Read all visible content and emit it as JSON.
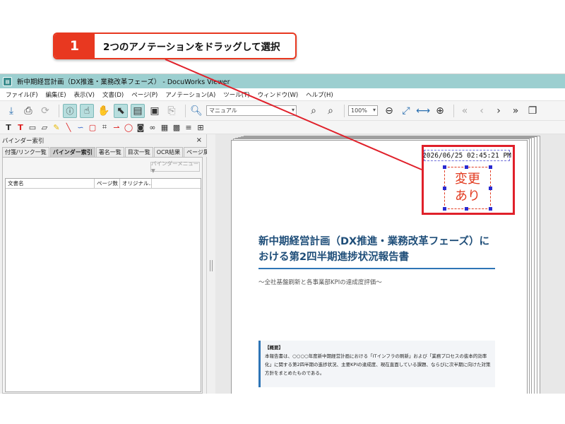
{
  "callout": {
    "step": "1",
    "text": "2つのアノテーションをドラッグして選択"
  },
  "window": {
    "title": "新中期経営計画（DX推進・業務改革フェーズ） - DocuWorks Viewer"
  },
  "menu": [
    "ファイル(F)",
    "編集(E)",
    "表示(V)",
    "文書(D)",
    "ページ(P)",
    "アノテーション(A)",
    "ツール(T)",
    "ウィンドウ(W)",
    "ヘルプ(H)"
  ],
  "toolbar": {
    "search_value": "マニュアル",
    "zoom_value": "100%"
  },
  "panel": {
    "title": "バインダー索引",
    "close": "×",
    "tabs": [
      "付箋/リンク一覧",
      "バインダー索引",
      "署名一覧",
      "目次一覧",
      "OCR結果",
      "ページ属性"
    ],
    "binder_menu": "バインダーメニュー ▼",
    "columns": [
      "文書名",
      "ページ数",
      "オリジナル..."
    ]
  },
  "document": {
    "date_stamp": "2026/06/25 02:45:21 PM",
    "change_stamp_line1": "変更",
    "change_stamp_line2": "あり",
    "title": "新中期経営計画（DX推進・業務改革フェーズ）における第2四半期進捗状況報告書",
    "subtitle": "～全社基盤刷新と各事業部KPIの達成度評価～",
    "summary_title": "【概要】",
    "summary_body": "本報告書は、○○○○年度新中期経営計画における「ITインフラの刷新」および「業務プロセスの抜本的効率化」に関する第2四半期の進捗状況、主要KPIの達成度、現在直面している課題、ならびに次半期に向けた対策方針をまとめたものである。"
  },
  "colors": {
    "accent_red": "#e83820",
    "titlebar": "#9ccfd0",
    "doc_blue": "#1f4e79"
  }
}
